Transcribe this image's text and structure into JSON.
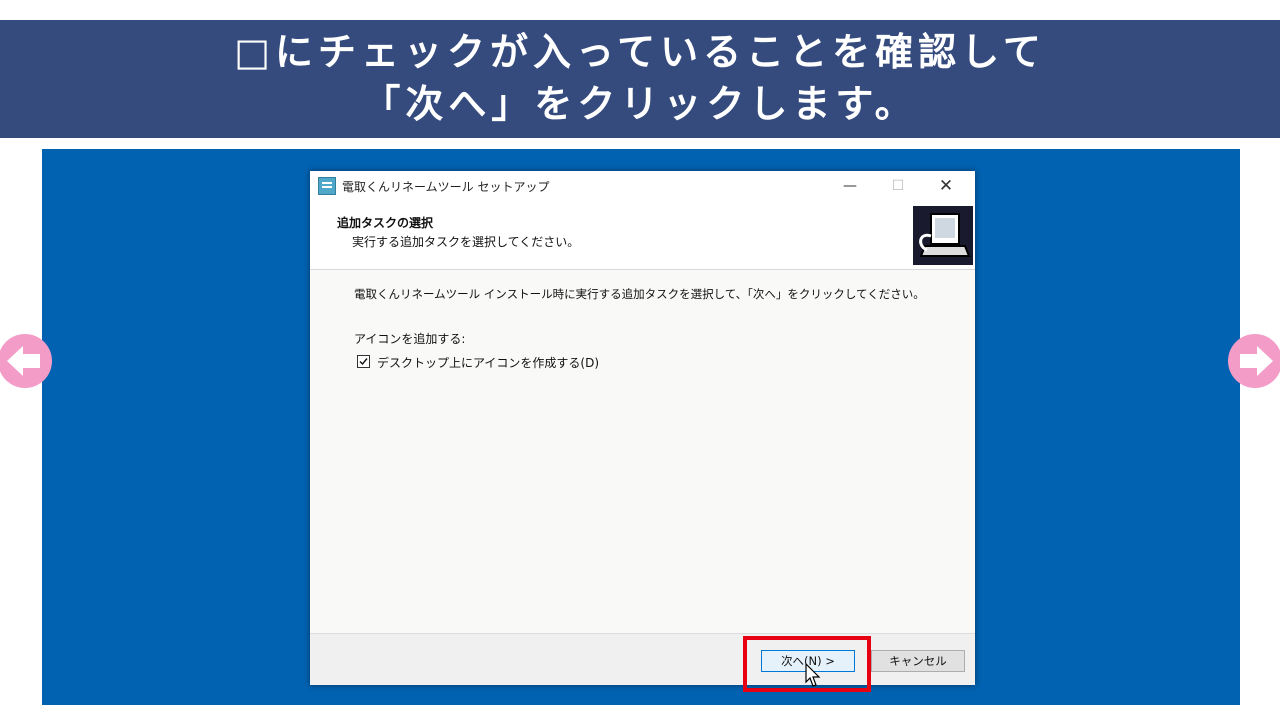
{
  "banner": {
    "line1": "□にチェックが入っていることを確認して",
    "line2": "「次へ」をクリックします。"
  },
  "dialog": {
    "title": "電取くんリネームツール セットアップ",
    "window_buttons": {
      "minimize": "—",
      "maximize": "☐",
      "close": "✕"
    },
    "header_title": "追加タスクの選択",
    "header_subtitle": "実行する追加タスクを選択してください。",
    "description": "電取くんリネームツール インストール時に実行する追加タスクを選択して、「次へ」をクリックしてください。",
    "group_label": "アイコンを追加する:",
    "checkbox": {
      "label": "デスクトップ上にアイコンを作成する(D)",
      "checked": true
    },
    "buttons": {
      "next": "次へ(N) >",
      "cancel": "キャンセル"
    }
  },
  "colors": {
    "banner_bg": "#354b7e",
    "stage_bg": "#0062b1",
    "nav_arrow": "#f39cc8",
    "highlight": "#e60012"
  },
  "icons": {
    "left_nav": "arrow-left-icon",
    "right_nav": "arrow-right-icon",
    "setup_logo": "computer-install-icon",
    "cursor": "mouse-pointer-icon"
  }
}
